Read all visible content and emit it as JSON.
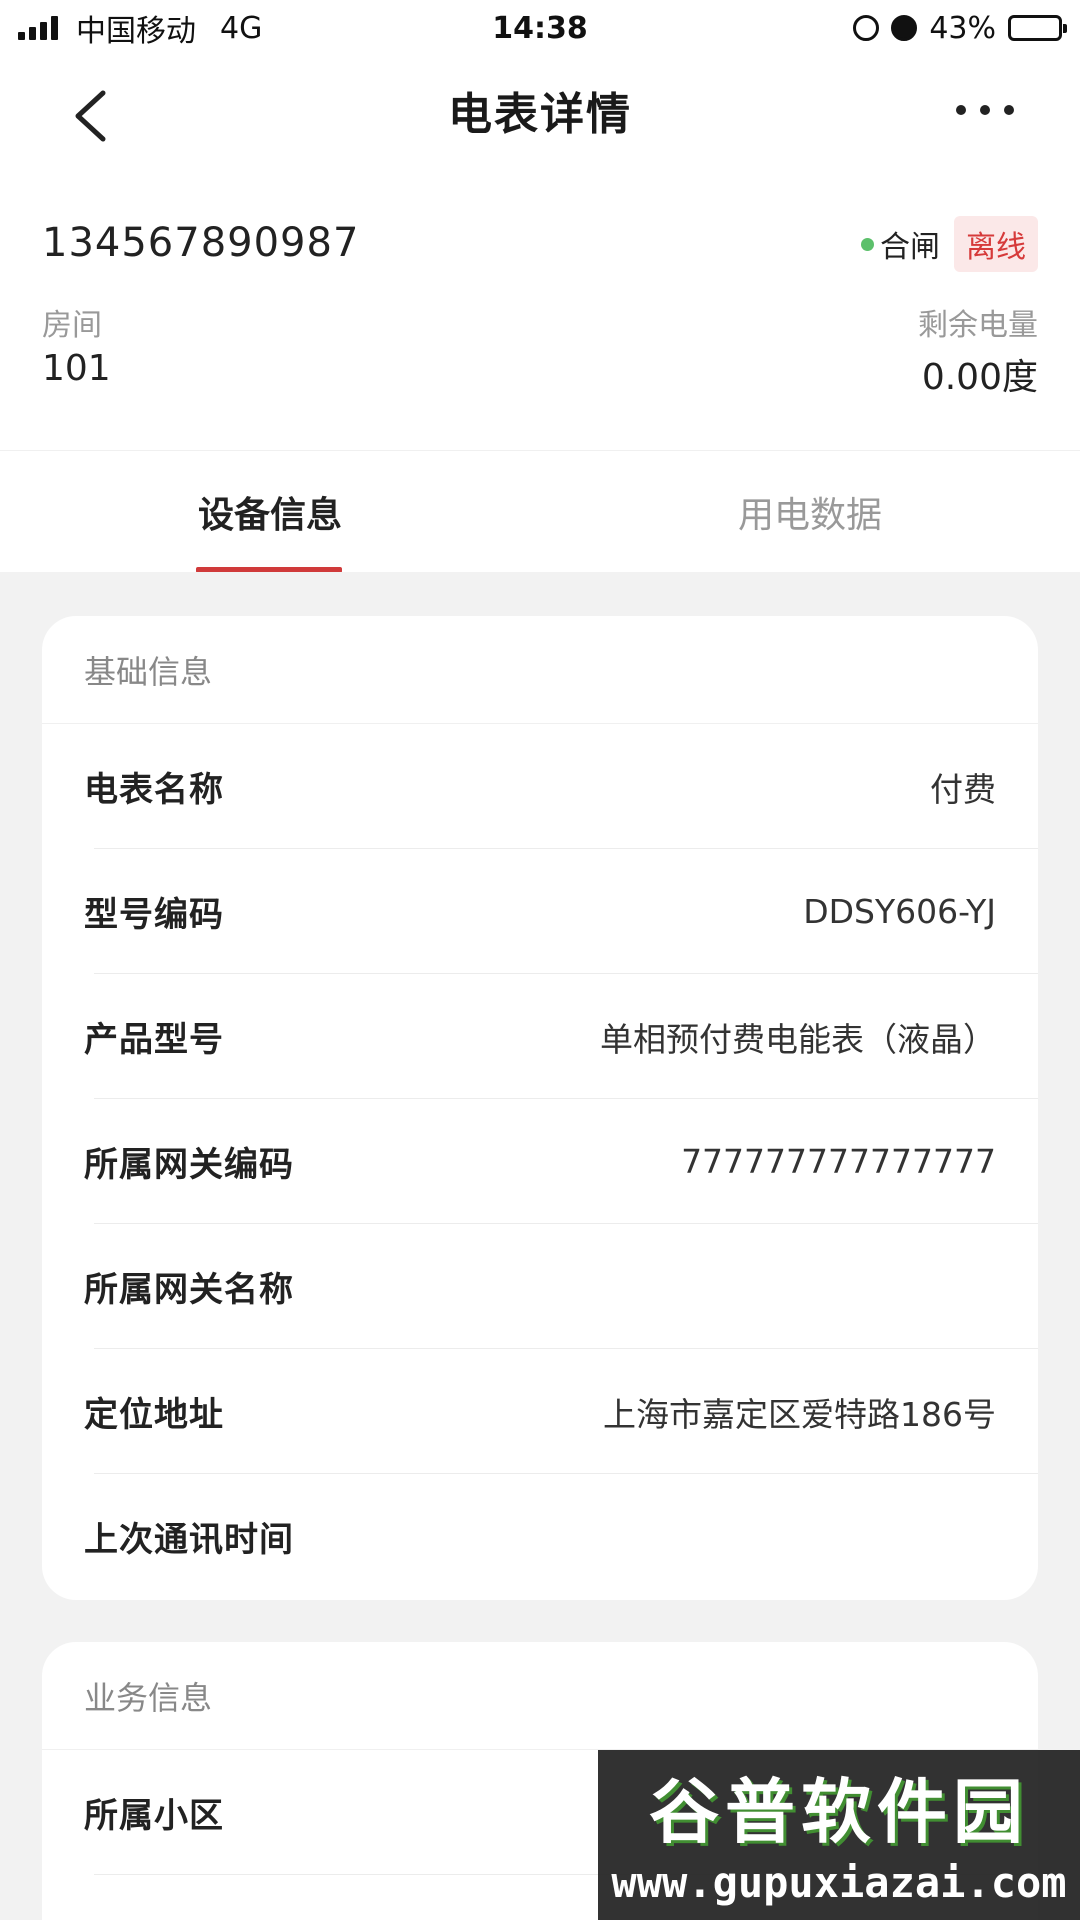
{
  "status_bar": {
    "carrier": "中国移动",
    "network": "4G",
    "time": "14:38",
    "battery": "43%",
    "battery_level": 0.43
  },
  "nav": {
    "title": "电表详情"
  },
  "meter": {
    "id": "134567890987",
    "switch_status": "合闸",
    "online_status": "离线",
    "room_label": "房间",
    "room_value": "101",
    "remain_label": "剩余电量",
    "remain_value": "0.00度",
    "colors": {
      "dot": "#5cc06b",
      "badge_text": "#d63a3a",
      "badge_bg": "#fbe8e8"
    }
  },
  "tabs": [
    {
      "label": "设备信息",
      "active": true
    },
    {
      "label": "用电数据",
      "active": false
    }
  ],
  "accent": "#d03a3a",
  "basic_info": {
    "title": "基础信息",
    "rows": [
      {
        "label": "电表名称",
        "value": "付费"
      },
      {
        "label": "型号编码",
        "value": "DDSY606-YJ"
      },
      {
        "label": "产品型号",
        "value": "单相预付费电能表（液晶）"
      },
      {
        "label": "所属网关编码",
        "value": "777777777777777"
      },
      {
        "label": "所属网关名称",
        "value": ""
      },
      {
        "label": "定位地址",
        "value": "上海市嘉定区爱特路186号"
      },
      {
        "label": "上次通讯时间",
        "value": ""
      }
    ]
  },
  "business_info": {
    "title": "业务信息",
    "rows": [
      {
        "label": "所属小区",
        "value": ""
      }
    ]
  },
  "watermark": {
    "title": "谷普软件园",
    "url": "www.gupuxiazai.com"
  }
}
